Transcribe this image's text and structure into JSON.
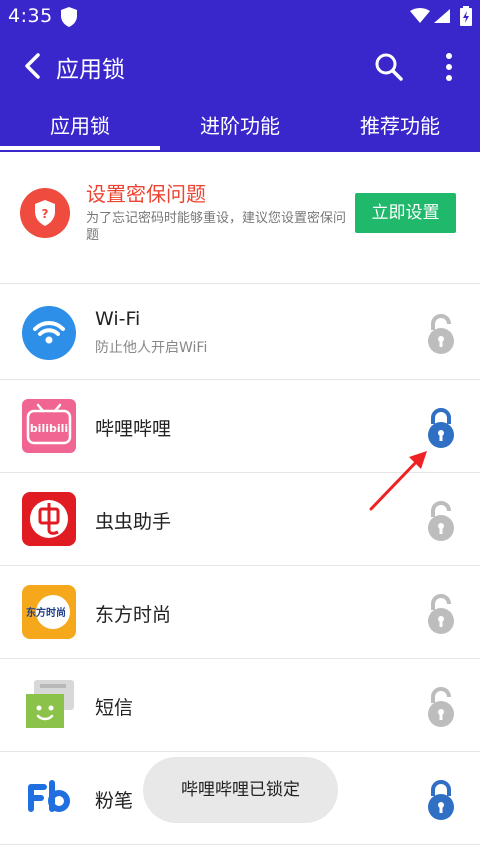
{
  "status_bar": {
    "time": "4:35"
  },
  "toolbar": {
    "title": "应用锁"
  },
  "tabs": [
    {
      "label": "应用锁",
      "selected": true
    },
    {
      "label": "进阶功能",
      "selected": false
    },
    {
      "label": "推荐功能",
      "selected": false
    }
  ],
  "banner": {
    "title": "设置密保问题",
    "description": "为了忘记密码时能够重设，建议您设置密保问题",
    "button": "立即设置"
  },
  "apps": [
    {
      "name": "Wi-Fi",
      "subtitle": "防止他人开启WiFi",
      "locked": false
    },
    {
      "name": "哔哩哔哩",
      "subtitle": "",
      "locked": true
    },
    {
      "name": "虫虫助手",
      "subtitle": "",
      "locked": false
    },
    {
      "name": "东方时尚",
      "subtitle": "",
      "locked": false
    },
    {
      "name": "短信",
      "subtitle": "",
      "locked": false
    },
    {
      "name": "粉笔",
      "subtitle": "",
      "locked": true
    }
  ],
  "icon_text": {
    "bilibili": "bilibili",
    "dongfang": "东方时尚"
  },
  "toast": "哔哩哔哩已锁定",
  "colors": {
    "primary": "#3a27cc",
    "accent_red": "#ee4433",
    "button_green": "#20b96c",
    "lock_locked": "#2f6fc4",
    "lock_unlocked": "#bdbdbd"
  }
}
